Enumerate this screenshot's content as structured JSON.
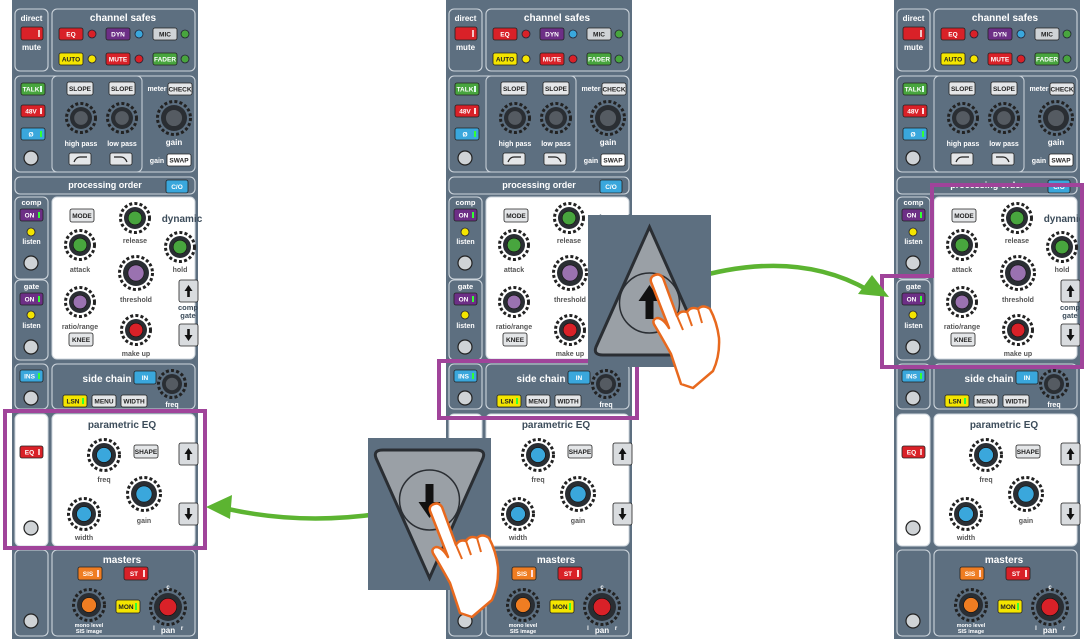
{
  "strip": {
    "direct": "direct",
    "mute": "mute",
    "channel_safes": "channel safes",
    "safes": [
      "EQ",
      "DYN",
      "MIC",
      "AUTO",
      "MUTE",
      "FADER"
    ],
    "talk": "TALK",
    "p48v": "48V",
    "phase": "Ø",
    "slope": "SLOPE",
    "meter": "meter",
    "check": "CHECK",
    "high_pass": "high pass",
    "low_pass": "low pass",
    "gain": "gain",
    "swap": "SWAP",
    "processing_order": "processing order",
    "co": "C/O",
    "comp": "comp",
    "on": "ON",
    "listen": "listen",
    "gate": "gate",
    "mode": "MODE",
    "release": "release",
    "dynamic": "dynamic",
    "attack": "attack",
    "hold": "hold",
    "threshold": "threshold",
    "comp_gate_1": "comp",
    "comp_gate_2": "gate",
    "ratio_range": "ratio/range",
    "knee": "KNEE",
    "make_up": "make up",
    "ins": "INS",
    "side_chain": "side chain",
    "in": "IN",
    "lsn": "LSN",
    "menu": "MENU",
    "width": "WIDTH",
    "freq": "freq",
    "parametric_eq": "parametric EQ",
    "eq": "EQ",
    "shape": "SHAPE",
    "width_knob": "width",
    "masters": "masters",
    "sis": "SIS",
    "st": "ST",
    "mon": "MON",
    "mono_level_1": "mono level",
    "mono_level_2": "SIS image",
    "pan": "pan",
    "pan_c": "c",
    "pan_l": "l",
    "pan_r": "r"
  },
  "colors": {
    "panel": "#5d6f80",
    "panel_dark": "#3c4c5a",
    "highlight": "#a0449a",
    "arrow": "#5cb431",
    "hand": "#e8691e",
    "eq_red": "#d92128",
    "dyn_purple": "#6d2f86",
    "mic_grey": "#cfd3d6",
    "auto_yellow": "#f4e500",
    "fader_green": "#48a53e",
    "blue": "#3aa7dc",
    "orange": "#ef7d22"
  }
}
